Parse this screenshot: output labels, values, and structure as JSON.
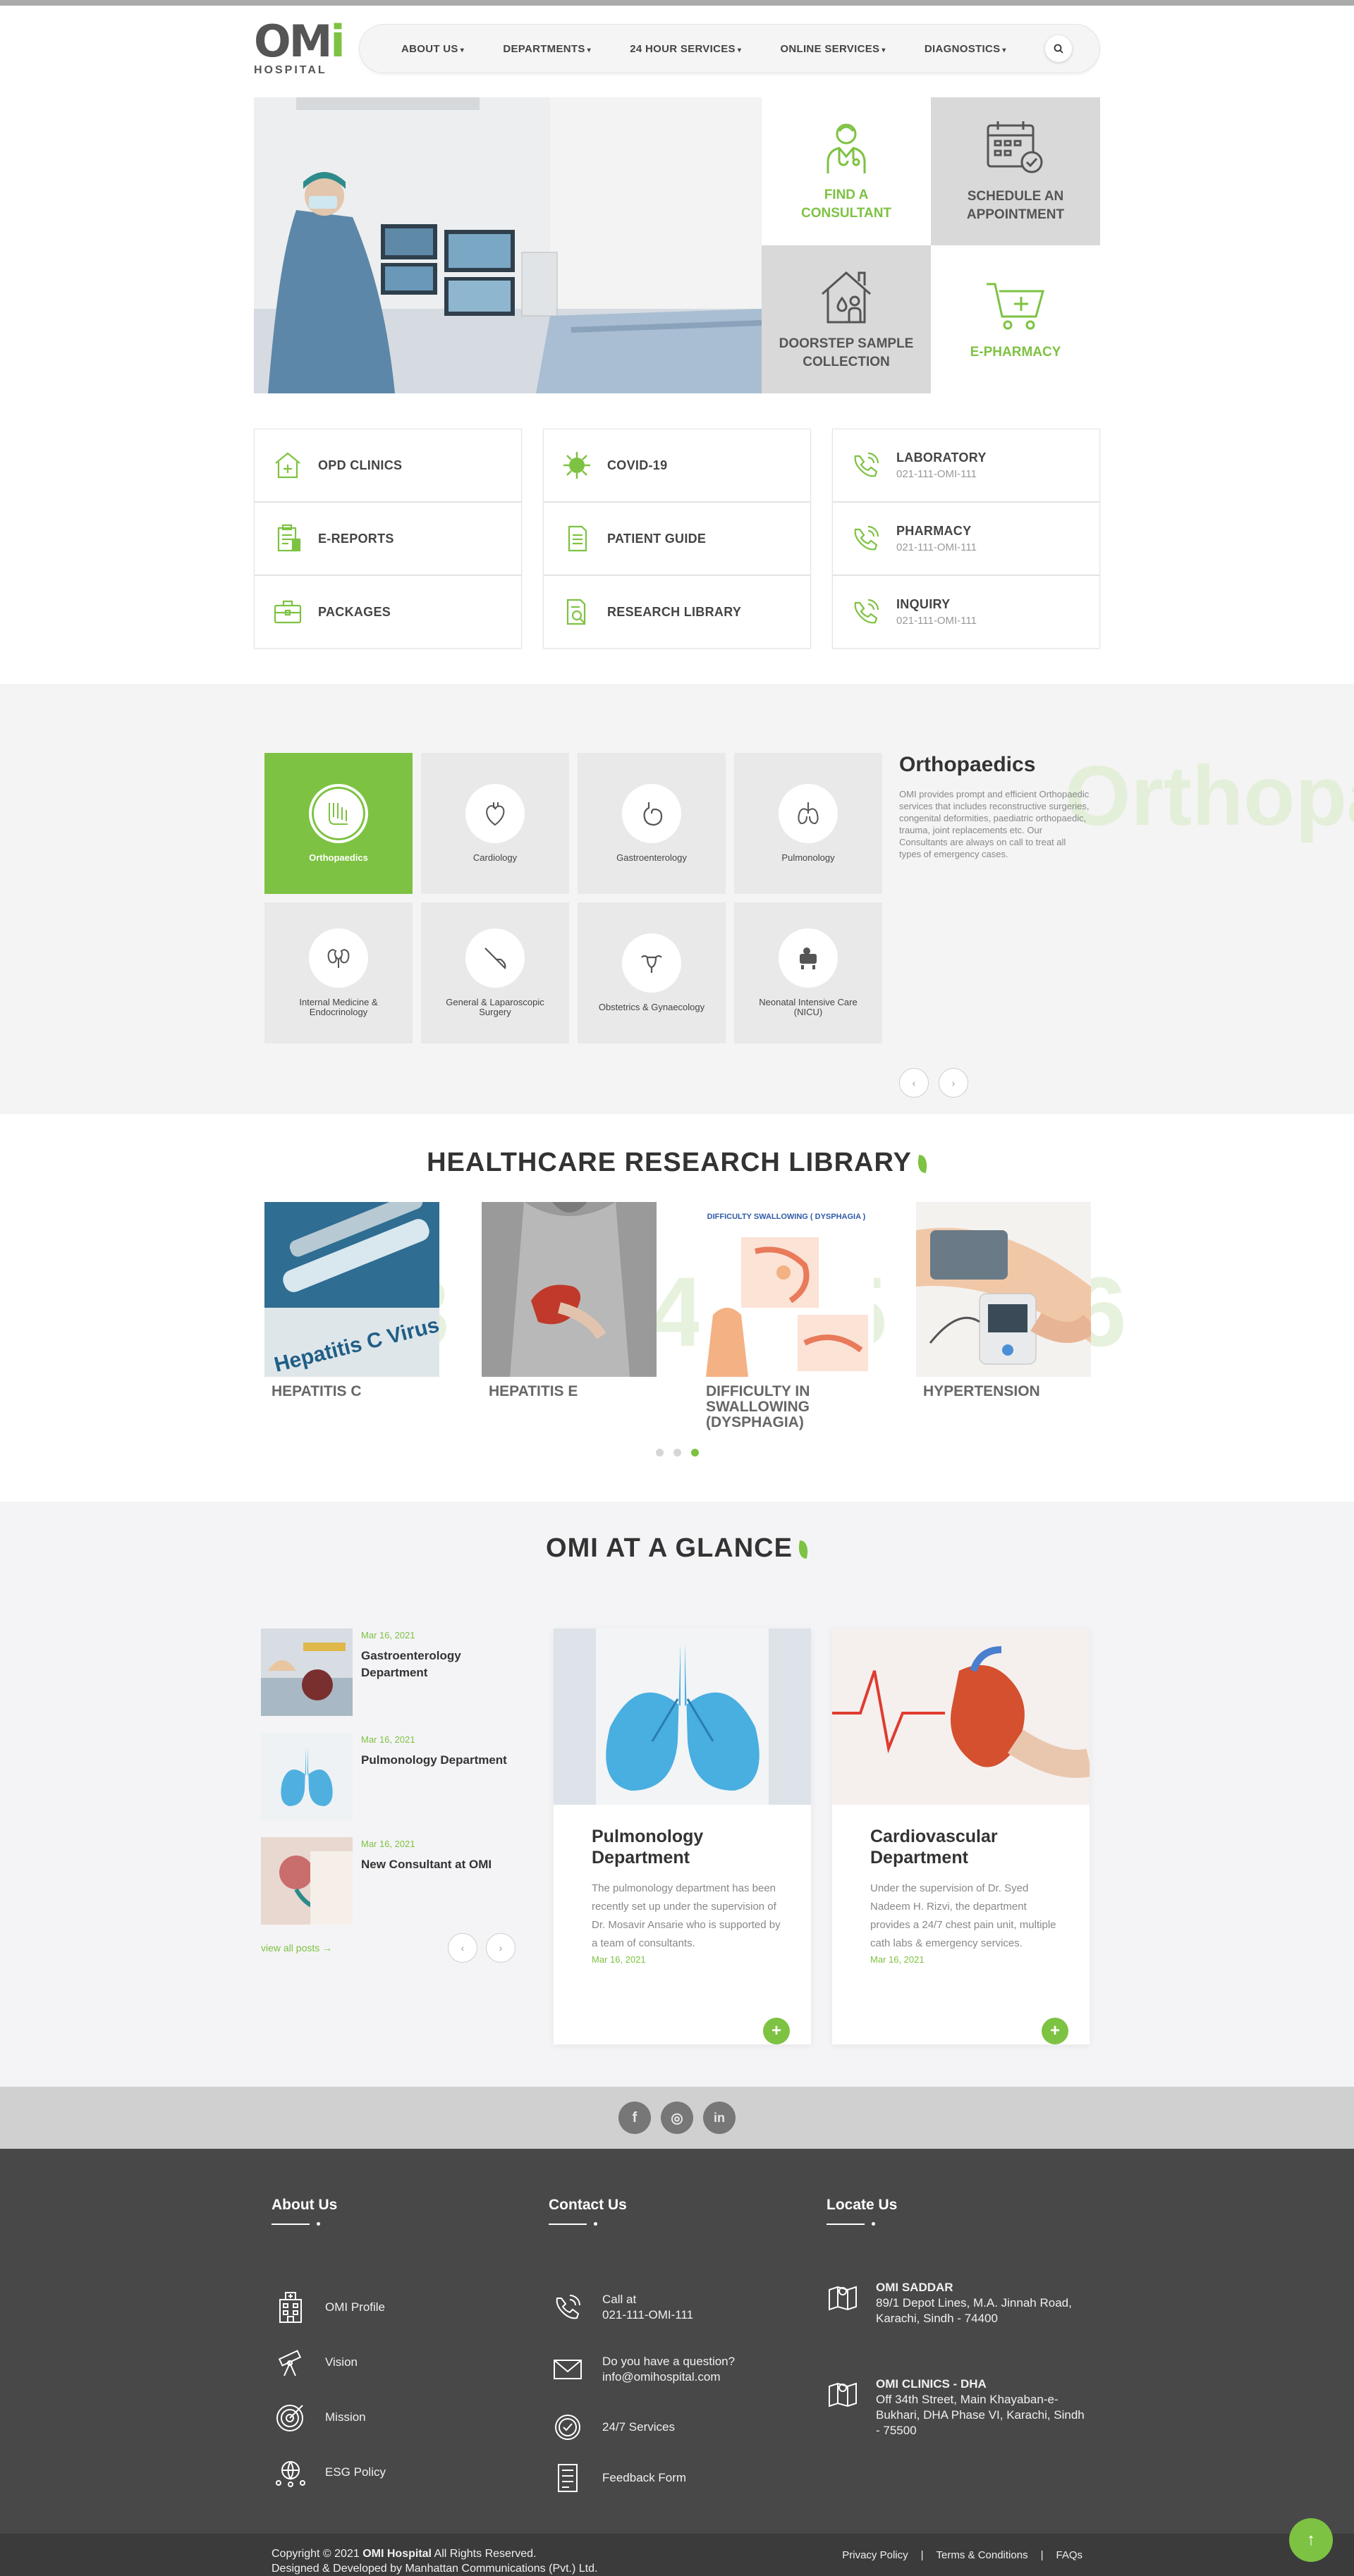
{
  "brand": {
    "logo_text_main": "OM",
    "logo_text_accent": "i",
    "logo_sub": "HOSPITAL",
    "accent_color": "#7dc242"
  },
  "nav": {
    "items": [
      {
        "label": "ABOUT US"
      },
      {
        "label": "DEPARTMENTS"
      },
      {
        "label": "24 HOUR SERVICES"
      },
      {
        "label": "ONLINE SERVICES"
      },
      {
        "label": "DIAGNOSTICS"
      }
    ],
    "search_icon": "search-icon"
  },
  "hero_tiles": [
    {
      "label": "FIND A CONSULTANT",
      "icon": "doctor-icon"
    },
    {
      "label": "SCHEDULE AN APPOINTMENT",
      "icon": "calendar-check-icon"
    },
    {
      "label": "DOORSTEP SAMPLE COLLECTION",
      "icon": "home-sample-icon"
    },
    {
      "label": "E-PHARMACY",
      "icon": "cart-plus-icon"
    }
  ],
  "quick_links": {
    "col1": [
      {
        "label": "OPD CLINICS",
        "icon": "clinic-icon"
      },
      {
        "label": "E-REPORTS",
        "icon": "report-icon"
      },
      {
        "label": "PACKAGES",
        "icon": "briefcase-icon"
      }
    ],
    "col2": [
      {
        "label": "COVID-19",
        "icon": "virus-icon"
      },
      {
        "label": "PATIENT GUIDE",
        "icon": "guide-icon"
      },
      {
        "label": "RESEARCH LIBRARY",
        "icon": "research-icon"
      }
    ],
    "col3": [
      {
        "label": "LABORATORY",
        "phone": "021-111-OMI-111",
        "icon": "phone-icon"
      },
      {
        "label": "PHARMACY",
        "phone": "021-111-OMI-111",
        "icon": "phone-icon"
      },
      {
        "label": "INQUIRY",
        "phone": "021-111-OMI-111",
        "icon": "phone-icon"
      }
    ]
  },
  "departments": {
    "items": [
      {
        "name": "Orthopaedics",
        "icon": "bone-icon"
      },
      {
        "name": "Cardiology",
        "icon": "heart-icon"
      },
      {
        "name": "Gastroenterology",
        "icon": "stomach-icon"
      },
      {
        "name": "Pulmonology",
        "icon": "lungs-icon"
      },
      {
        "name": "Internal Medicine & Endocrinology",
        "icon": "kidneys-icon"
      },
      {
        "name": "General & Laparoscopic Surgery",
        "icon": "scalpel-icon"
      },
      {
        "name": "Obstetrics & Gynaecology",
        "icon": "uterus-icon"
      },
      {
        "name": "Neonatal Intensive Care (NICU)",
        "icon": "incubator-icon"
      }
    ],
    "active_title": "Orthopaedics",
    "active_description": "OMI provides prompt and efficient Orthopaedic services that includes reconstructive surgeries, congenital deformities, paediatric orthopaedic, trauma, joint replacements etc. Our Consultants are always on call to treat all types of emergency cases.",
    "watermark": "Orthopaedics"
  },
  "research": {
    "title": "HEALTHCARE RESEARCH LIBRARY",
    "cards": [
      {
        "title": "HEPATITIS C",
        "image_text": "Hepatitis C Virus"
      },
      {
        "title": "HEPATITIS E"
      },
      {
        "title": "DIFFICULTY IN SWALLOWING (DYSPHAGIA)",
        "image_text": "DIFFICULTY SWALLOWING ( DYSPHAGIA )"
      },
      {
        "title": "HYPERTENSION"
      }
    ],
    "active_dot": 3
  },
  "glance": {
    "title": "OMI AT A GLANCE",
    "news": [
      {
        "date": "Mar 16, 2021",
        "title": "Gastroenterology Department"
      },
      {
        "date": "Mar 16, 2021",
        "title": "Pulmonology Department"
      },
      {
        "date": "Mar 16, 2021",
        "title": "New Consultant at OMI"
      }
    ],
    "view_all": "view all posts →",
    "cards": [
      {
        "title": "Pulmonology Department",
        "desc": "The pulmonology department has been recently set up under the supervision of Dr. Mosavir Ansarie who is supported by a team of consultants.",
        "date": "Mar 16, 2021"
      },
      {
        "title": "Cardiovascular Department",
        "desc": "Under the supervision of Dr. Syed Nadeem H. Rizvi, the department provides a 24/7 chest pain unit, multiple cath labs & emergency services.",
        "date": "Mar 16, 2021"
      }
    ]
  },
  "social": [
    {
      "label": "f",
      "icon": "facebook-icon"
    },
    {
      "label": "◎",
      "icon": "instagram-icon"
    },
    {
      "label": "in",
      "icon": "linkedin-icon"
    }
  ],
  "footer": {
    "about": {
      "title": "About Us",
      "items": [
        "OMI Profile",
        "Vision",
        "Mission",
        "ESG Policy"
      ]
    },
    "contact": {
      "title": "Contact Us",
      "call_label": "Call at",
      "call_number": "021-111-OMI-111",
      "question_label": "Do you have a question?",
      "email": "info@omihospital.com",
      "services": "24/7 Services",
      "feedback": "Feedback Form"
    },
    "locate": {
      "title": "Locate Us",
      "loc1_name": "OMI SADDAR",
      "loc1_addr": "89/1 Depot Lines, M.A. Jinnah Road, Karachi, Sindh - 74400",
      "loc2_name": "OMI CLINICS - DHA",
      "loc2_addr": "Off 34th Street, Main Khayaban-e-Bukhari, DHA Phase VI, Karachi, Sindh - 75500"
    }
  },
  "copyright": {
    "line1_prefix": "Copyright © 2021",
    "line1_brand": "OMI Hospital",
    "line1_suffix": "All Rights Reserved.",
    "line2": "Designed & Developed by Manhattan Communications (Pvt.) Ltd.",
    "links": [
      "Privacy Policy",
      "|",
      "Terms & Conditions",
      "|",
      "FAQs"
    ]
  }
}
